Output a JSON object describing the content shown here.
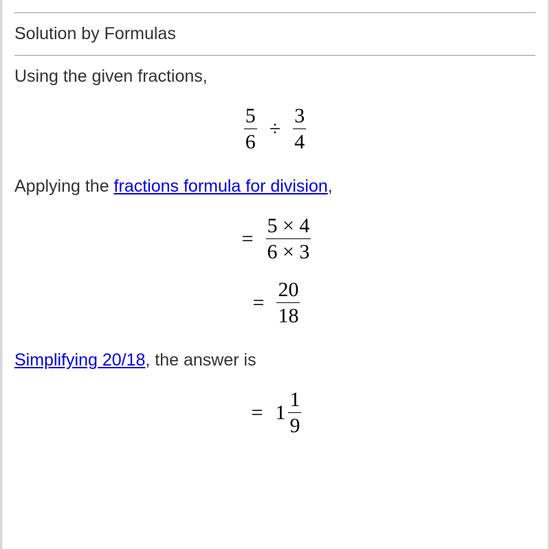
{
  "section_title": "Solution by Formulas",
  "text": {
    "intro": "Using the given fractions,",
    "applying_pre": "Applying the ",
    "applying_link": "fractions formula for division",
    "applying_post": ",",
    "simplify_link": "Simplifying 20/18",
    "simplify_post": ", the answer is"
  },
  "math": {
    "eq1": {
      "f1_num": "5",
      "f1_den": "6",
      "op": "÷",
      "f2_num": "3",
      "f2_den": "4"
    },
    "eq2": {
      "prefix": "=",
      "num": "5 × 4",
      "den": "6 × 3"
    },
    "eq3": {
      "prefix": "=",
      "num": "20",
      "den": "18"
    },
    "eq4": {
      "prefix": "=",
      "whole": "1",
      "num": "1",
      "den": "9"
    }
  }
}
